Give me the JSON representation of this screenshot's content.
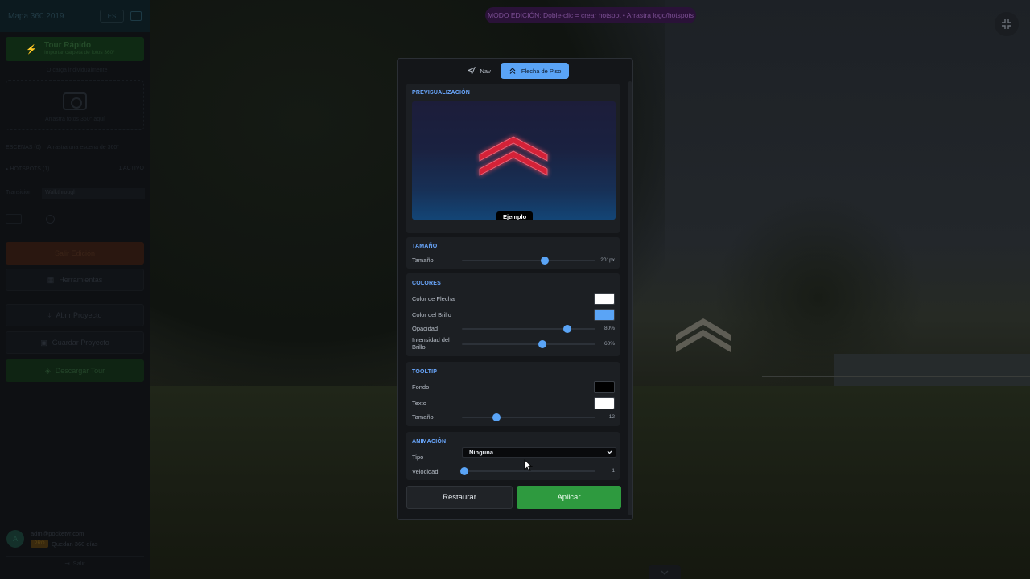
{
  "topbar": {
    "logo_text": "Mapa 360 2019",
    "lang": "ES"
  },
  "banner": {
    "text": "MODO EDICIÓN: Doble-clic = crear hotspot • Arrastra logo/hotspots"
  },
  "sidebar": {
    "tour_title": "Tour Rápido",
    "tour_subtitle": "Importar carpeta de fotos 360°",
    "folder_hint": "O carga individualmente",
    "upload_label": "Arrastra fotos 360° aquí",
    "scenes_label": "ESCENAS (0)",
    "scenes_hint": "Arrastra una escena de 360°",
    "hotspots_label": "HOTSPOTS (1)",
    "hotspots_count": "1 ACTIVO",
    "transition_label": "Transición",
    "transition_value": "Walkthrough",
    "exit_label": "Salir Edición",
    "tools_label": "Herramientas",
    "open_label": "Abrir Proyecto",
    "save_label": "Guardar Proyecto",
    "download_label": "Descargar Tour",
    "user_initial": "A",
    "user_email": "adm@pocketvr.com",
    "user_badge": "PRO",
    "user_days": "Quedan 360 días",
    "logout_label": "Salir"
  },
  "modal": {
    "tabs": [
      {
        "label": "Nav",
        "icon": "navigation-icon"
      },
      {
        "label": "Flecha de Piso",
        "icon": "chevrons-up-icon"
      }
    ],
    "preview": {
      "title": "PREVISUALIZACIÓN",
      "example_label": "Ejemplo"
    },
    "size": {
      "title": "TAMAÑO",
      "label": "Tamaño",
      "value_text": "201px",
      "fraction": 0.62
    },
    "colors": {
      "title": "COLORES",
      "arrow_color_label": "Color de Flecha",
      "arrow_color": "#ffffff",
      "glow_color_label": "Color del Brillo",
      "glow_color": "#5aa4f6",
      "opacity_label": "Opacidad",
      "opacity_text": "80%",
      "opacity_fraction": 0.79,
      "intensity_label": "Intensidad del Brillo",
      "intensity_text": "60%",
      "intensity_fraction": 0.6
    },
    "tooltip": {
      "title": "TOOLTIP",
      "bg_label": "Fondo",
      "bg_color": "#000000",
      "text_label": "Texto",
      "text_color": "#ffffff",
      "size_label": "Tamaño",
      "size_text": "12",
      "size_fraction": 0.26
    },
    "animation": {
      "title": "ANIMACIÓN",
      "type_label": "Tipo",
      "type_value": "Ninguna",
      "speed_label": "Velocidad",
      "speed_text": "1",
      "speed_fraction": 0.02
    },
    "reset_label": "Restaurar",
    "apply_label": "Aplicar"
  },
  "accent_color": "#5aa4f6",
  "apply_color": "#2e9a3f"
}
